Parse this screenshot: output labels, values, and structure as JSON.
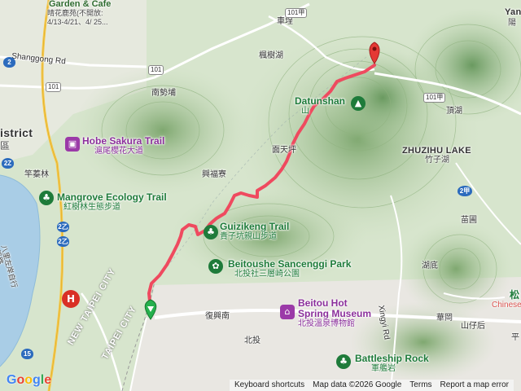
{
  "labels": {
    "cafe_en": "Garden & Cafe",
    "cafe_zh": "晴花鹿苑(不開放:",
    "cafe_dates": "4/13-4/21、4/ 25...",
    "shanggong_rd": "Shanggong Rd",
    "district_en": "istrict",
    "district_zh": "區",
    "hobe_en": "Hobe Sakura Trail",
    "hobe_zh": "滬尾櫻花大道",
    "mangrove_en": "Mangrove Ecology Trail",
    "mangrove_zh": "紅樹林生態步道",
    "zhuwei": "竿蓁林",
    "nanshipu": "南勢埔",
    "fengshuhu": "楓樹湖",
    "cheqian": "車埕",
    "datun_en": "Datunshan",
    "datun_zh": "山",
    "dingshuhu": "頂湖",
    "zhuzihu_en": "ZHUZIHU LAKE",
    "zhuzihu_zh": "竹子湖",
    "miantianping": "面天坪",
    "xingfuliao": "興福寮",
    "guizikeng_en": "Guizikeng Trail",
    "guizikeng_zh": "貴子坑親山步道",
    "beitoushe_en": "Beitoushe Sancenggi Park",
    "beitoushe_zh": "北投社三層崎公園",
    "hot_spring_en": "Beitou Hot",
    "hot_spring_en2": "Spring Museum",
    "hot_spring_zh": "北投溫泉博物館",
    "battleship_en": "Battleship Rock",
    "battleship_zh": "軍艦岩",
    "fuxingnan": "復興南",
    "beitou": "北投",
    "huting": "湖底",
    "miaopu": "苗圃",
    "huagang": "華岡",
    "shanzihou": "山仔后",
    "xingyi_rd": "Xingyi Rd",
    "new_taipei_city": "NEW TAIPEI CITY",
    "taipei_city": "TAIPEI CITY",
    "yang": "Yan",
    "yang_zh": "陽",
    "sung_en": "松",
    "chinese": "Chinese",
    "ping": "平",
    "bali": "八里左岸自行",
    "bali2": "溪路",
    "route_101": "101",
    "route_101a_top": "101甲",
    "route_101a_right": "101甲",
    "hw_2z": "2Z",
    "hw_2z_b": "2乙",
    "hw_2z_c": "2乙",
    "hw_15": "15",
    "hw_2": "2",
    "hw_2b": "2甲"
  },
  "footer": {
    "shortcuts": "Keyboard shortcuts",
    "mapdata": "Map data ©2026 Google",
    "terms": "Terms",
    "report": "Report a map error"
  },
  "logo": "Google",
  "colors": {
    "route": "#ef4a5f",
    "water": "#a9cde6",
    "park": "#b7d9a8",
    "urban": "#e8e6e1",
    "start_marker": "#25b04d",
    "end_marker": "#e53935"
  }
}
